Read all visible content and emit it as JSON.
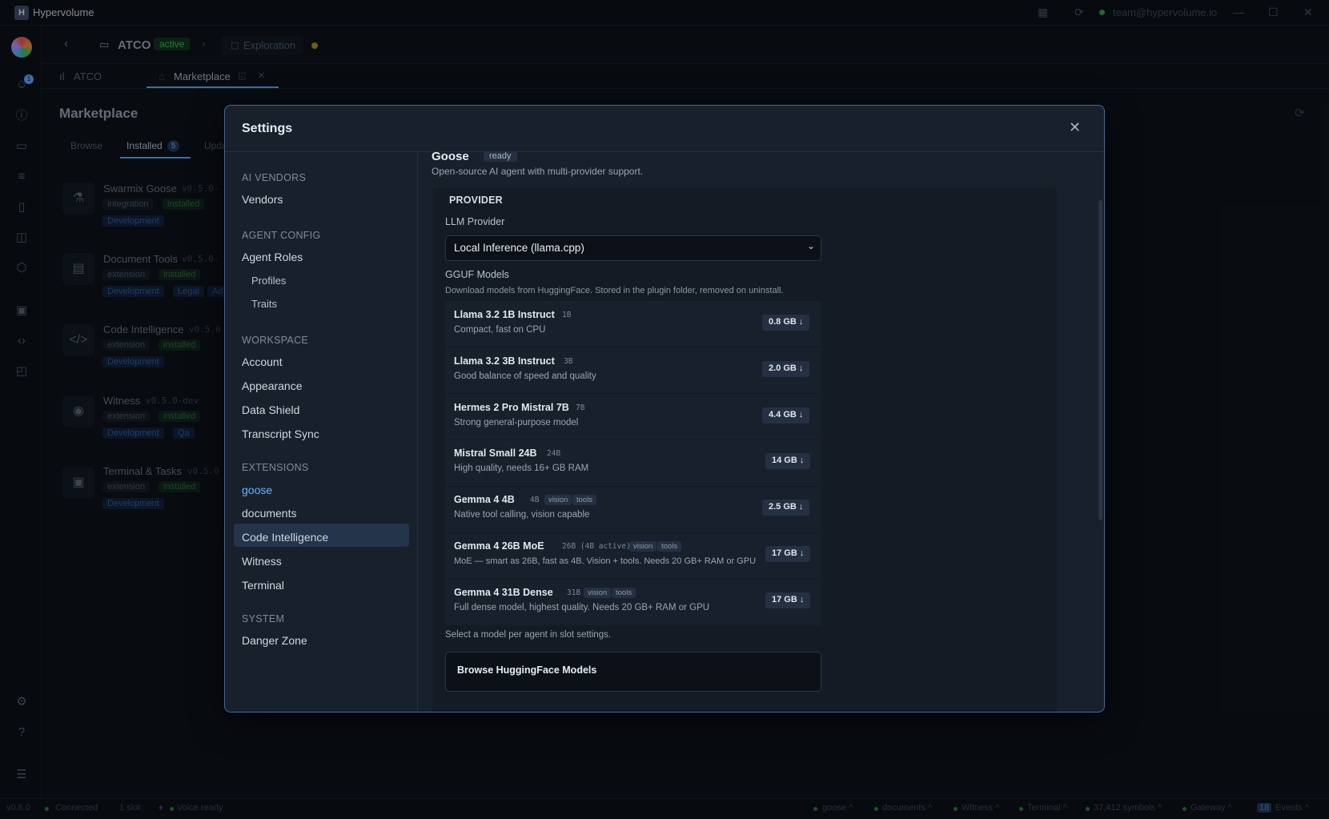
{
  "app": {
    "logo_letter": "H",
    "title": "Hypervolume",
    "account_email": "team@hypervolume.io"
  },
  "breadcrumb": {
    "project": "ATCO",
    "status": "active",
    "mode": "Exploration"
  },
  "tabs": [
    {
      "label": "ATCO"
    },
    {
      "label": "Marketplace"
    }
  ],
  "marketplace": {
    "title": "Marketplace",
    "subtabs": {
      "browse": "Browse",
      "installed": "Installed",
      "installed_count": "5",
      "updates": "Upda"
    },
    "cards": [
      {
        "name": "Swarmix Goose",
        "version": "v0.5.0-",
        "type": "integration",
        "state": "installed",
        "tags": [
          "Development"
        ]
      },
      {
        "name": "Document Tools",
        "version": "v0.5.0-",
        "type": "extension",
        "state": "installed",
        "tags": [
          "Development",
          "Legal",
          "Ad"
        ]
      },
      {
        "name": "Code Intelligence",
        "version": "v0.5.0",
        "type": "extension",
        "state": "installed",
        "tags": [
          "Development"
        ]
      },
      {
        "name": "Witness",
        "version": "v0.5.0-dev",
        "type": "extension",
        "state": "installed",
        "tags": [
          "Development",
          "Qa"
        ]
      },
      {
        "name": "Terminal & Tasks",
        "version": "v0.5.0",
        "type": "extension",
        "state": "installed",
        "tags": [
          "Development"
        ]
      }
    ]
  },
  "settings": {
    "title": "Settings",
    "nav": {
      "ai_vendors_head": "AI VENDORS",
      "vendors": "Vendors",
      "agent_config_head": "AGENT CONFIG",
      "agent_roles": "Agent Roles",
      "profiles": "Profiles",
      "traits": "Traits",
      "workspace_head": "WORKSPACE",
      "account": "Account",
      "appearance": "Appearance",
      "data_shield": "Data Shield",
      "transcript_sync": "Transcript Sync",
      "extensions_head": "EXTENSIONS",
      "goose": "goose",
      "documents": "documents",
      "code_intelligence": "Code Intelligence",
      "witness": "Witness",
      "terminal": "Terminal",
      "system_head": "SYSTEM",
      "danger_zone": "Danger Zone"
    },
    "goose": {
      "title": "Goose",
      "status": "ready",
      "description": "Open-source AI agent with multi-provider support.",
      "provider_head": "PROVIDER",
      "llm_provider_label": "LLM Provider",
      "llm_provider_value": "Local Inference (llama.cpp)",
      "gguf_label": "GGUF Models",
      "gguf_desc": "Download models from HuggingFace. Stored in the plugin folder, removed on uninstall.",
      "models": [
        {
          "name": "Llama 3.2 1B Instruct",
          "param": "1B",
          "tags": [],
          "desc": "Compact, fast on CPU",
          "size": "0.8 GB ↓"
        },
        {
          "name": "Llama 3.2 3B Instruct",
          "param": "3B",
          "tags": [],
          "desc": "Good balance of speed and quality",
          "size": "2.0 GB ↓"
        },
        {
          "name": "Hermes 2 Pro Mistral 7B",
          "param": "7B",
          "tags": [],
          "desc": "Strong general-purpose model",
          "size": "4.4 GB ↓"
        },
        {
          "name": "Mistral Small 24B",
          "param": "24B",
          "tags": [],
          "desc": "High quality, needs 16+ GB RAM",
          "size": "14 GB ↓"
        },
        {
          "name": "Gemma 4 4B",
          "param": "4B",
          "tags": [
            "vision",
            "tools"
          ],
          "desc": "Native tool calling, vision capable",
          "size": "2.5 GB ↓"
        },
        {
          "name": "Gemma 4 26B MoE",
          "param": "26B (4B active)",
          "tags": [
            "vision",
            "tools"
          ],
          "desc": "MoE — smart as 26B, fast as 4B. Vision + tools. Needs 20 GB+ RAM or GPU",
          "size": "17 GB ↓"
        },
        {
          "name": "Gemma 4 31B Dense",
          "param": "31B",
          "tags": [
            "vision",
            "tools"
          ],
          "desc": "Full dense model, highest quality. Needs 20 GB+ RAM or GPU",
          "size": "17 GB ↓"
        }
      ],
      "select_note": "Select a model per agent in slot settings.",
      "browse_label": "Browse HuggingFace Models"
    }
  },
  "statusbar": {
    "version": "v0.6.0",
    "connected": "Connected",
    "slots": "1 slot",
    "voice": "Voice ready",
    "items": [
      "goose ^",
      "documents ^",
      "Witness ^",
      "Terminal ^",
      "37,412 symbols ^",
      "Gateway ^"
    ],
    "events_count": "18",
    "events": "Events ^"
  }
}
